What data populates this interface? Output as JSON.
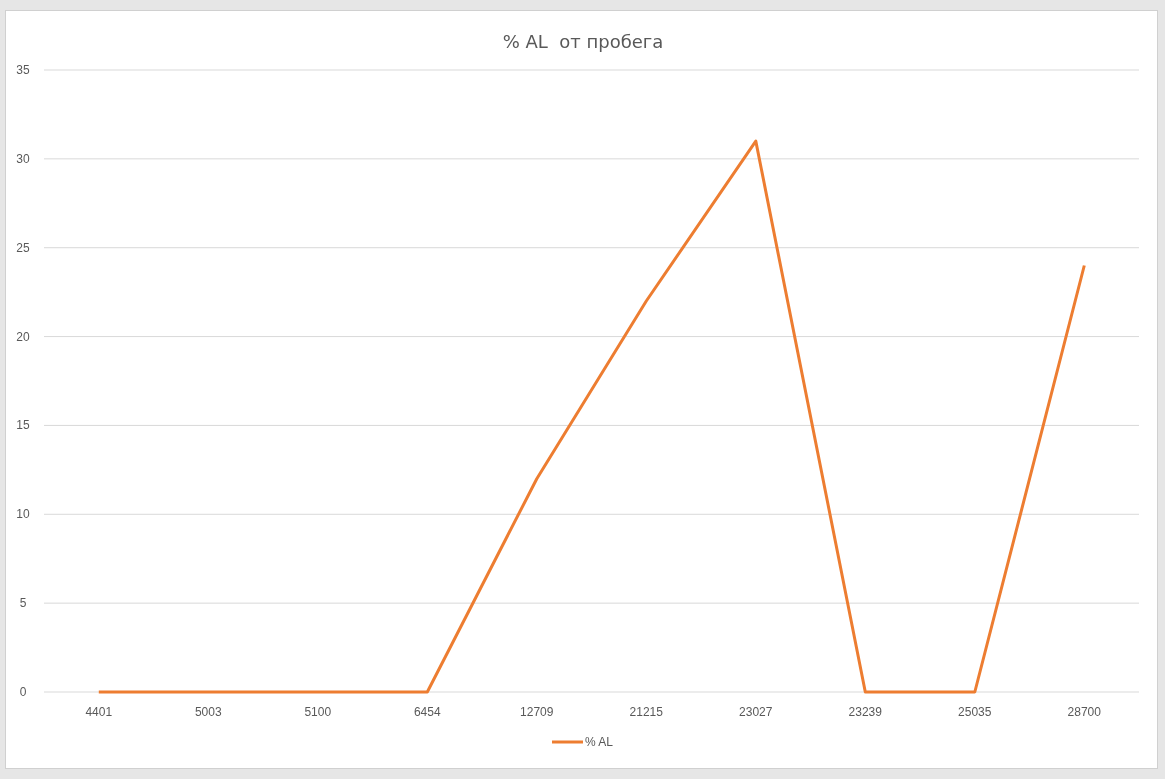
{
  "chart": {
    "chart_data": {
      "type": "line",
      "title": "% AL  от пробега",
      "categories": [
        "4401",
        "5003",
        "5100",
        "6454",
        "12709",
        "21215",
        "23027",
        "23239",
        "25035",
        "28700"
      ],
      "series": [
        {
          "name": "% AL",
          "color": "#ed7d31",
          "values": [
            0,
            0,
            0,
            0,
            12,
            22,
            31,
            0,
            0,
            24
          ]
        }
      ],
      "ylim": [
        0,
        35
      ],
      "grid": true,
      "yticks": [
        0,
        5,
        10,
        15,
        20,
        25,
        30,
        35
      ]
    }
  }
}
